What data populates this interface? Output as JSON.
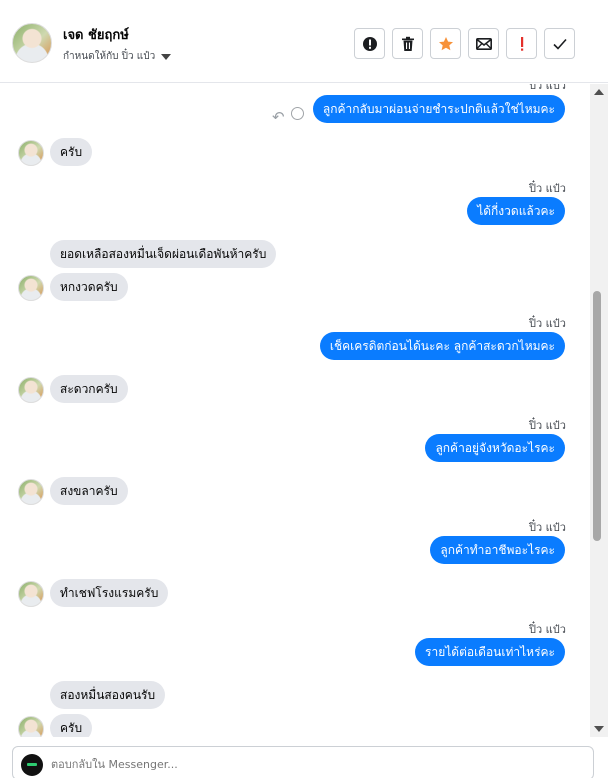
{
  "header": {
    "contact_name": "เจด ชัยฤกษ์",
    "assigned_to": "กำหนดให้กับ ปิ๋ว แป๋ว"
  },
  "actions": [
    {
      "name": "report-spam-button",
      "icon": "alert-circle-icon"
    },
    {
      "name": "delete-button",
      "icon": "trash-icon"
    },
    {
      "name": "star-button",
      "icon": "star-icon"
    },
    {
      "name": "mark-unread-button",
      "icon": "envelope-icon"
    },
    {
      "name": "follow-up-button",
      "icon": "exclamation-icon"
    },
    {
      "name": "mark-done-button",
      "icon": "check-icon"
    }
  ],
  "colors": {
    "outgoing_bubble": "#0a7cff",
    "incoming_bubble": "#e4e6eb",
    "star": "#f7923a",
    "follow_up": "#e4302b"
  },
  "messages": {
    "m0_sender": "ปิ๋ว แป๋ว",
    "m0": "ลูกค้ากลับมาผ่อนจ่ายชำระปกติแล้วใช่ไหมคะ",
    "m1": "ครับ",
    "m2_sender": "ปิ๋ว แป๋ว",
    "m2": "ได้กี่งวดแล้วคะ",
    "m3": "ยอดเหลือสองหมื่นเจ็ดผ่อนเดือพันห้าครับ",
    "m4": "หกงวดครับ",
    "m5_sender": "ปิ๋ว แป๋ว",
    "m5": "เช็คเครดิตก่อนได้นะคะ  ลูกค้าสะดวกไหมคะ",
    "m6": "สะดวกครับ",
    "m7_sender": "ปิ๋ว แป๋ว",
    "m7": "ลูกค้าอยู่จังหวัดอะไรคะ",
    "m8": "สงขลาครับ",
    "m9_sender": "ปิ๋ว แป๋ว",
    "m9": "ลูกค้าทำอาชีพอะไรคะ",
    "m10": "ทำเชฟโรงแรมครับ",
    "m11_sender": "ปิ๋ว แป๋ว",
    "m11": "รายได้ต่อเดือนเท่าไหร่คะ",
    "m12": "สองหมื่นสองคนรับ",
    "m13": "ครับ"
  },
  "composer": {
    "placeholder": "ตอบกลับใน Messenger..."
  }
}
